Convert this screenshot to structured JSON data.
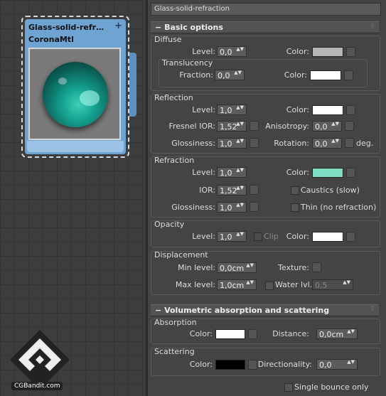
{
  "node": {
    "title": "Glass-solid-refr…",
    "subtitle": "CoronaMtl",
    "plus": "+"
  },
  "logo": {
    "text": "CGBandit.com"
  },
  "panel": {
    "material_name": "Glass-solid-refraction",
    "basic_options": {
      "title": "Basic options"
    },
    "diffuse": {
      "title": "Diffuse",
      "level_label": "Level:",
      "level_value": "0,0",
      "color_label": "Color:",
      "color": "#b6b6b6",
      "translucency": {
        "title": "Translucency",
        "fraction_label": "Fraction:",
        "fraction_value": "0,0",
        "color_label": "Color:",
        "color": "#ffffff"
      }
    },
    "reflection": {
      "title": "Reflection",
      "level_label": "Level:",
      "level_value": "1,0",
      "color_label": "Color:",
      "color": "#ffffff",
      "fresnel_label": "Fresnel IOR:",
      "fresnel_value": "1,52",
      "aniso_label": "Anisotropy:",
      "aniso_value": "0,0",
      "gloss_label": "Glossiness:",
      "gloss_value": "1,0",
      "rotation_label": "Rotation:",
      "rotation_value": "0,0",
      "deg_label": "deg."
    },
    "refraction": {
      "title": "Refraction",
      "level_label": "Level:",
      "level_value": "1,0",
      "color_label": "Color:",
      "color": "#7fdcc2",
      "ior_label": "IOR:",
      "ior_value": "1,52",
      "caustics_label": "Caustics (slow)",
      "gloss_label": "Glossiness:",
      "gloss_value": "1,0",
      "thin_label": "Thin (no refraction)"
    },
    "opacity": {
      "title": "Opacity",
      "level_label": "Level:",
      "level_value": "1,0",
      "clip_label": "Clip",
      "color_label": "Color:",
      "color": "#ffffff"
    },
    "displacement": {
      "title": "Displacement",
      "min_label": "Min level:",
      "min_value": "0,0cm",
      "texture_label": "Texture:",
      "max_label": "Max level:",
      "max_value": "1,0cm",
      "water_label": "Water lvl.:",
      "water_value": "0,5"
    },
    "volumetric": {
      "title": "Volumetric absorption and scattering"
    },
    "absorption": {
      "title": "Absorption",
      "color_label": "Color:",
      "color": "#ffffff",
      "distance_label": "Distance:",
      "distance_value": "0,0cm"
    },
    "scattering": {
      "title": "Scattering",
      "color_label": "Color:",
      "color": "#000000",
      "dir_label": "Directionality:",
      "dir_value": "0,0",
      "single_label": "Single bounce only"
    },
    "grip": "⠿",
    "minus": "−",
    "spin_arrows": "▲▼"
  }
}
